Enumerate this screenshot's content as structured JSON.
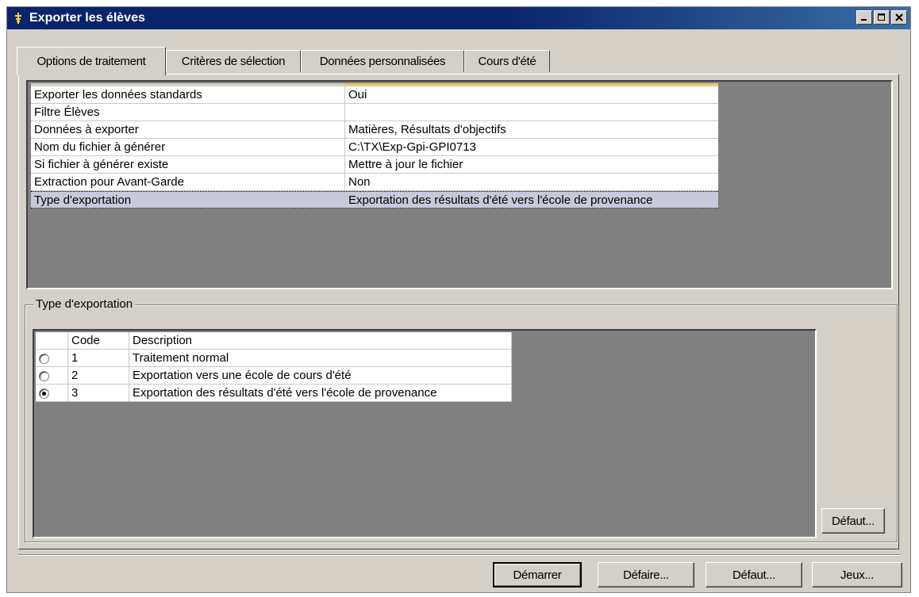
{
  "window": {
    "title": "Exporter les élèves"
  },
  "tabs": [
    {
      "label": "Options de traitement",
      "active": true
    },
    {
      "label": "Critères de sélection",
      "active": false
    },
    {
      "label": "Données personnalisées",
      "active": false
    },
    {
      "label": "Cours d'été",
      "active": false
    }
  ],
  "properties": [
    {
      "name": "Exporter les données standards",
      "value": "Oui"
    },
    {
      "name": "Filtre Élèves",
      "value": ""
    },
    {
      "name": "Données à exporter",
      "value": "Matières, Résultats d'objectifs"
    },
    {
      "name": "Nom du fichier à générer",
      "value": "C:\\TX\\Exp-Gpi-GPI0713"
    },
    {
      "name": "Si fichier à générer existe",
      "value": "Mettre à jour le fichier"
    },
    {
      "name": "Extraction pour Avant-Garde",
      "value": "Non"
    },
    {
      "name": "Type d'exportation",
      "value": "Exportation des résultats d'été vers l'école de provenance",
      "selected": true
    }
  ],
  "export_type": {
    "legend": "Type d'exportation",
    "headers": {
      "code": "Code",
      "description": "Description"
    },
    "rows": [
      {
        "code": "1",
        "description": "Traitement normal",
        "checked": false
      },
      {
        "code": "2",
        "description": "Exportation vers une école de cours d'été",
        "checked": false
      },
      {
        "code": "3",
        "description": "Exportation des résultats d'été vers l'école de provenance",
        "checked": true
      }
    ],
    "default_button": "Défaut..."
  },
  "footer": {
    "start": "Démarrer",
    "undo": "Défaire...",
    "default": "Défaut...",
    "sets": "Jeux..."
  },
  "colors": {
    "titlebar": "#0a246a",
    "dialog_bg": "#d4d0c8",
    "grid_bg": "#808080",
    "selected_row": "#c7c9dc"
  }
}
